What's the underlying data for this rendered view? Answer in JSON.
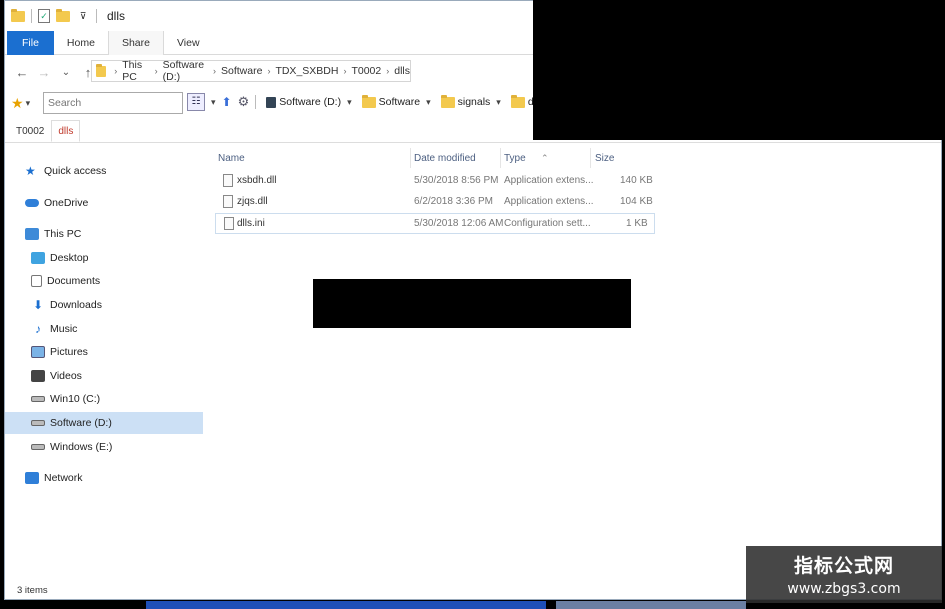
{
  "window": {
    "title": "dlls"
  },
  "ribbon": {
    "tabs": [
      "File",
      "Home",
      "Share",
      "View"
    ]
  },
  "nav": {
    "back": "←",
    "forward": "→",
    "recent": "⌄",
    "up": "↑"
  },
  "address": {
    "crumbs": [
      "This PC",
      "Software (D:)",
      "Software",
      "TDX_SXBDH",
      "T0002",
      "dlls"
    ],
    "sep": "›"
  },
  "search": {
    "placeholder": "Search"
  },
  "toolbar": {
    "drive_label": "Software (D:)",
    "folders": [
      "Software",
      "signals",
      "dlls"
    ],
    "dropdown": "▾"
  },
  "folder_tabs": [
    "T0002",
    "dlls"
  ],
  "nav_pane": {
    "items": [
      {
        "label": "Quick access",
        "icon": "star-icon"
      },
      {
        "label": "OneDrive",
        "icon": "cloud-icon"
      },
      {
        "label": "This PC",
        "icon": "computer-icon"
      },
      {
        "label": "Desktop",
        "icon": "desktop-icon"
      },
      {
        "label": "Documents",
        "icon": "documents-icon"
      },
      {
        "label": "Downloads",
        "icon": "downloads-icon"
      },
      {
        "label": "Music",
        "icon": "music-icon"
      },
      {
        "label": "Pictures",
        "icon": "pictures-icon"
      },
      {
        "label": "Videos",
        "icon": "videos-icon"
      },
      {
        "label": "Win10 (C:)",
        "icon": "drive-icon"
      },
      {
        "label": "Software (D:)",
        "icon": "drive-icon"
      },
      {
        "label": "Windows (E:)",
        "icon": "drive-icon"
      },
      {
        "label": "Network",
        "icon": "network-icon"
      }
    ]
  },
  "file_list": {
    "columns": [
      "Name",
      "Date modified",
      "Type",
      "Size"
    ],
    "rows": [
      {
        "name": "xsbdh.dll",
        "date": "5/30/2018 8:56 PM",
        "type": "Application extens...",
        "size": "140 KB"
      },
      {
        "name": "zjqs.dll",
        "date": "6/2/2018 3:36 PM",
        "type": "Application extens...",
        "size": "104 KB"
      },
      {
        "name": "dlls.ini",
        "date": "5/30/2018 12:06 AM",
        "type": "Configuration sett...",
        "size": "1 KB"
      }
    ]
  },
  "status": {
    "text": "3 items"
  },
  "watermark": {
    "line1": "指标公式网",
    "line2": "www.zbgs3.com"
  },
  "colors": {
    "accent": "#1b6fd0",
    "selection": "#cce0f5",
    "active_tab_text": "#c0392b"
  }
}
